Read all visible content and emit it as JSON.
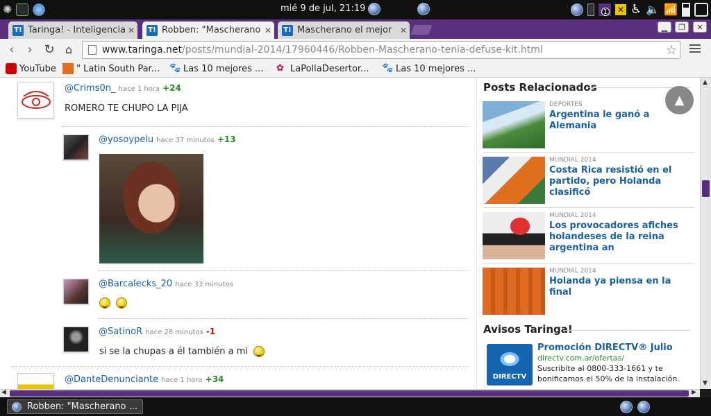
{
  "system_panel": {
    "clock": "mié  9 de jul, 21:19",
    "notification_count": "1"
  },
  "browser": {
    "tabs": [
      {
        "label": "Taringa! - Inteligencia c",
        "active": false
      },
      {
        "label": "Robben: \"Mascherano",
        "active": true
      },
      {
        "label": "Mascherano el mejor",
        "active": false
      }
    ],
    "tab_favicon": "T!",
    "url_host": "www.taringa.net",
    "url_path": "/posts/mundial-2014/17960446/Robben-Mascherano-tenia-defuse-kit.html",
    "bookmarks": [
      {
        "label": "YouTube",
        "icon": "youtube-icon"
      },
      {
        "label": "\" Latin South Par...",
        "icon": "page-icon"
      },
      {
        "label": "Las 10 mejores ...",
        "icon": "paw-icon"
      },
      {
        "label": "LaPollaDesertor...",
        "icon": "flower-icon"
      },
      {
        "label": "Las 10 mejores ...",
        "icon": "paw-icon"
      }
    ]
  },
  "comments": [
    {
      "user": "@Crims0n_",
      "time": "hace 1 hora",
      "vote": "+24",
      "text": "ROMERO TE CHUPO LA PIJA"
    },
    {
      "user": "@yosoypelu",
      "time": "hace 37 minutos",
      "vote": "+13",
      "text": ""
    },
    {
      "user": "@Barcalecks_20",
      "time": "hace 33 minutos",
      "vote": "",
      "text": ""
    },
    {
      "user": "@SatinoR",
      "time": "hace 28 minutos",
      "vote": "-1",
      "text": "si se la chupas a él también a mi"
    },
    {
      "user": "@DanteDenunciante",
      "time": "hace 1 hora",
      "vote": "+34",
      "text": ""
    }
  ],
  "sidebar": {
    "related_title": "Posts Relacionados",
    "related": [
      {
        "category": "DEPORTES",
        "title": "Argentina le ganó a Alemania"
      },
      {
        "category": "MUNDIAL 2014",
        "title": "Costa Rica resistió en el partido, pero Holanda clasificó"
      },
      {
        "category": "MUNDIAL 2014",
        "title": "Los provocadores afiches holandeses de la reina argentina an"
      },
      {
        "category": "MUNDIAL 2014",
        "title": "Holanda ya piensa en la final"
      }
    ],
    "ads_title": "Avisos Taringa!",
    "ad": {
      "title": "Promoción DIRECTV® Julio",
      "url": "directv.com.ar/ofertas/",
      "description": "Suscribite al 0800-333-1661 y te bonificamos el 50% de la instalación.",
      "logo_text": "DIRECTV"
    }
  },
  "taskbar": {
    "item_label": "Robben: \"Mascherano ..."
  },
  "colors": {
    "accent": "#5a2f7e",
    "link": "#1a5f9e",
    "vote_positive": "#2a8a2a",
    "vote_negative": "#cc0000"
  }
}
